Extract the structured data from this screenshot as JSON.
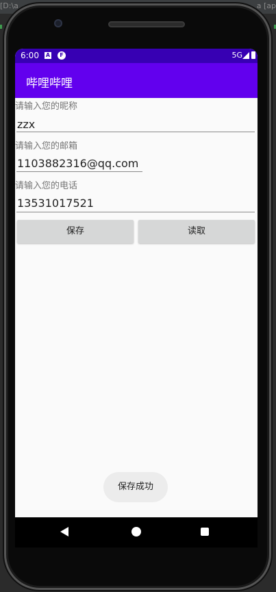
{
  "ide": {
    "left_text": "[D:\\a",
    "right_text": "a [ap"
  },
  "status_bar": {
    "time": "6:00",
    "notification_a": "A",
    "notification_f": "F",
    "network": "5G"
  },
  "app_bar": {
    "title": "哔哩哔哩"
  },
  "form": {
    "nickname": {
      "label": "请输入您的昵称",
      "value": "zzx"
    },
    "email": {
      "label": "请输入您的邮箱",
      "value": "1103882316@qq.com"
    },
    "phone": {
      "label": "请输入您的电话",
      "value": "13531017521"
    }
  },
  "buttons": {
    "save": "保存",
    "read": "读取"
  },
  "toast": {
    "message": "保存成功"
  },
  "colors": {
    "status_bar": "#3700b3",
    "app_bar": "#6200ee",
    "background": "#fafafa",
    "button": "#d6d7d7"
  },
  "icons": [
    "signal-icon",
    "battery-icon",
    "back-icon",
    "home-icon",
    "recents-icon"
  ]
}
